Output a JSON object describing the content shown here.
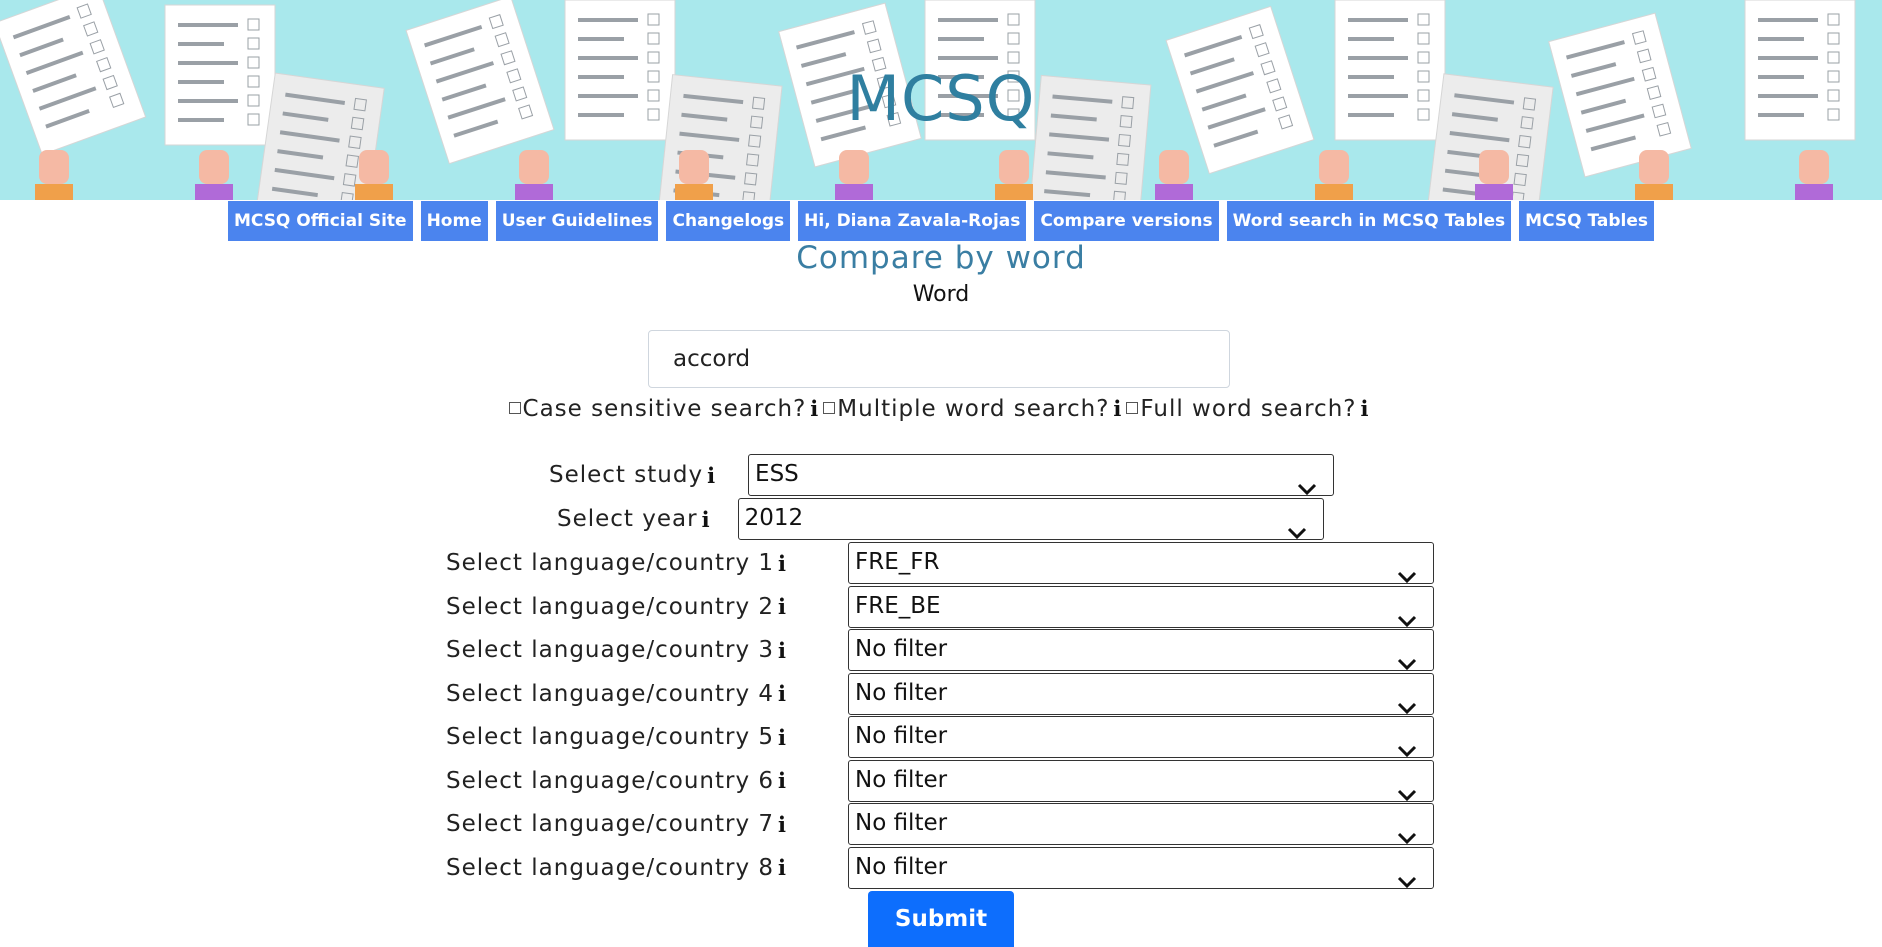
{
  "site": {
    "title": "MCSQ"
  },
  "nav": [
    {
      "label": "MCSQ Official Site",
      "name": "nav-mcsq-official-site"
    },
    {
      "label": "Home",
      "name": "nav-home"
    },
    {
      "label": "User Guidelines",
      "name": "nav-user-guidelines"
    },
    {
      "label": "Changelogs",
      "name": "nav-changelogs"
    },
    {
      "label": "Hi, Diana Zavala-Rojas",
      "name": "nav-user-greeting"
    },
    {
      "label": "Compare versions",
      "name": "nav-compare-versions"
    },
    {
      "label": "Word search in MCSQ Tables",
      "name": "nav-word-search"
    },
    {
      "label": "MCSQ Tables",
      "name": "nav-mcsq-tables"
    }
  ],
  "page": {
    "heading": "Compare by word"
  },
  "form": {
    "word_label": "Word",
    "word_value": "accord",
    "options": [
      {
        "label": "Case sensitive search?",
        "checked": false
      },
      {
        "label": "Multiple word search?",
        "checked": false
      },
      {
        "label": "Full word search?",
        "checked": false
      }
    ],
    "info_glyph": "i",
    "study": {
      "label": "Select study",
      "value": "ESS"
    },
    "year": {
      "label": "Select year",
      "value": "2012"
    },
    "languages": [
      {
        "label": "Select language/country 1",
        "value": "FRE_FR"
      },
      {
        "label": "Select language/country 2",
        "value": "FRE_BE"
      },
      {
        "label": "Select language/country 3",
        "value": "No filter"
      },
      {
        "label": "Select language/country 4",
        "value": "No filter"
      },
      {
        "label": "Select language/country 5",
        "value": "No filter"
      },
      {
        "label": "Select language/country 6",
        "value": "No filter"
      },
      {
        "label": "Select language/country 7",
        "value": "No filter"
      },
      {
        "label": "Select language/country 8",
        "value": "No filter"
      }
    ],
    "submit_label": "Submit"
  },
  "colors": {
    "banner_bg": "#a9e8ec",
    "nav_bg": "#4b84ee",
    "submit_bg": "#0d6efd",
    "heading": "#3a7ea3"
  }
}
